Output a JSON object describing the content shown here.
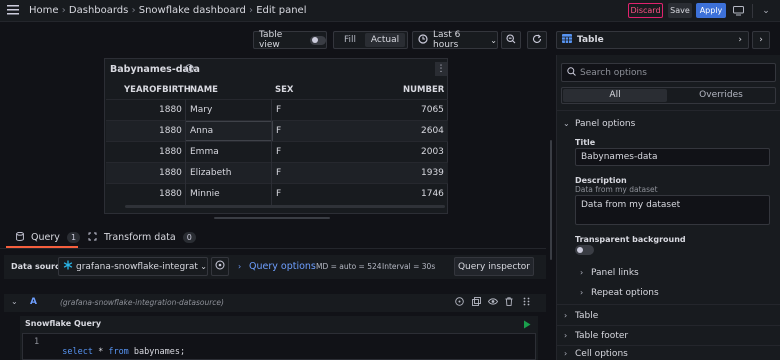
{
  "breadcrumb": {
    "home": "Home",
    "dashboards": "Dashboards",
    "dashboard": "Snowflake dashboard",
    "current": "Edit panel"
  },
  "actions": {
    "discard": "Discard",
    "save": "Save",
    "apply": "Apply"
  },
  "toolbar": {
    "table_view": "Table view",
    "fill": "Fill",
    "actual": "Actual",
    "time_range": "Last 6 hours"
  },
  "panel": {
    "title": "Babynames-data",
    "columns": [
      "YEAROFBIRTH",
      "NAME",
      "SEX",
      "NUMBER"
    ],
    "rows": [
      [
        "1880",
        "Mary",
        "F",
        "7065"
      ],
      [
        "1880",
        "Anna",
        "F",
        "2604"
      ],
      [
        "1880",
        "Emma",
        "F",
        "2003"
      ],
      [
        "1880",
        "Elizabeth",
        "F",
        "1939"
      ],
      [
        "1880",
        "Minnie",
        "F",
        "1746"
      ]
    ]
  },
  "query_tabs": {
    "query_label": "Query",
    "query_count": "1",
    "transform_label": "Transform data",
    "transform_count": "0"
  },
  "query_bar": {
    "data_source_label": "Data source",
    "data_source_value": "grafana-snowflake-integration",
    "query_options": "Query options",
    "md": "MD = auto = 524",
    "interval": "Interval = 30s",
    "inspector": "Query inspector"
  },
  "query_row": {
    "ref": "A",
    "datasource": "(grafana-snowflake-integration-datasource)",
    "editor_title": "Snowflake Query",
    "line_number": "1",
    "sql_keyword1": "select",
    "sql_rest": " * ",
    "sql_keyword2": "from",
    "sql_table": " babynames;"
  },
  "viz": {
    "name": "Table"
  },
  "options": {
    "search_placeholder": "Search options",
    "tab_all": "All",
    "tab_overrides": "Overrides",
    "panel_options": "Panel options",
    "title_label": "Title",
    "title_value": "Babynames-data",
    "description_label": "Description",
    "description_hint": "Data from my dataset",
    "description_value": "Data from my dataset",
    "transparent_label": "Transparent background",
    "panel_links": "Panel links",
    "repeat_options": "Repeat options",
    "section_table": "Table",
    "section_table_footer": "Table footer",
    "section_cell_options": "Cell options"
  },
  "colors": {
    "accent_blue": "#3d71d9",
    "discard_red": "#e0226e",
    "active_tab_underline": "#f55f3e",
    "background": "#111217",
    "panel": "#181b1f"
  }
}
